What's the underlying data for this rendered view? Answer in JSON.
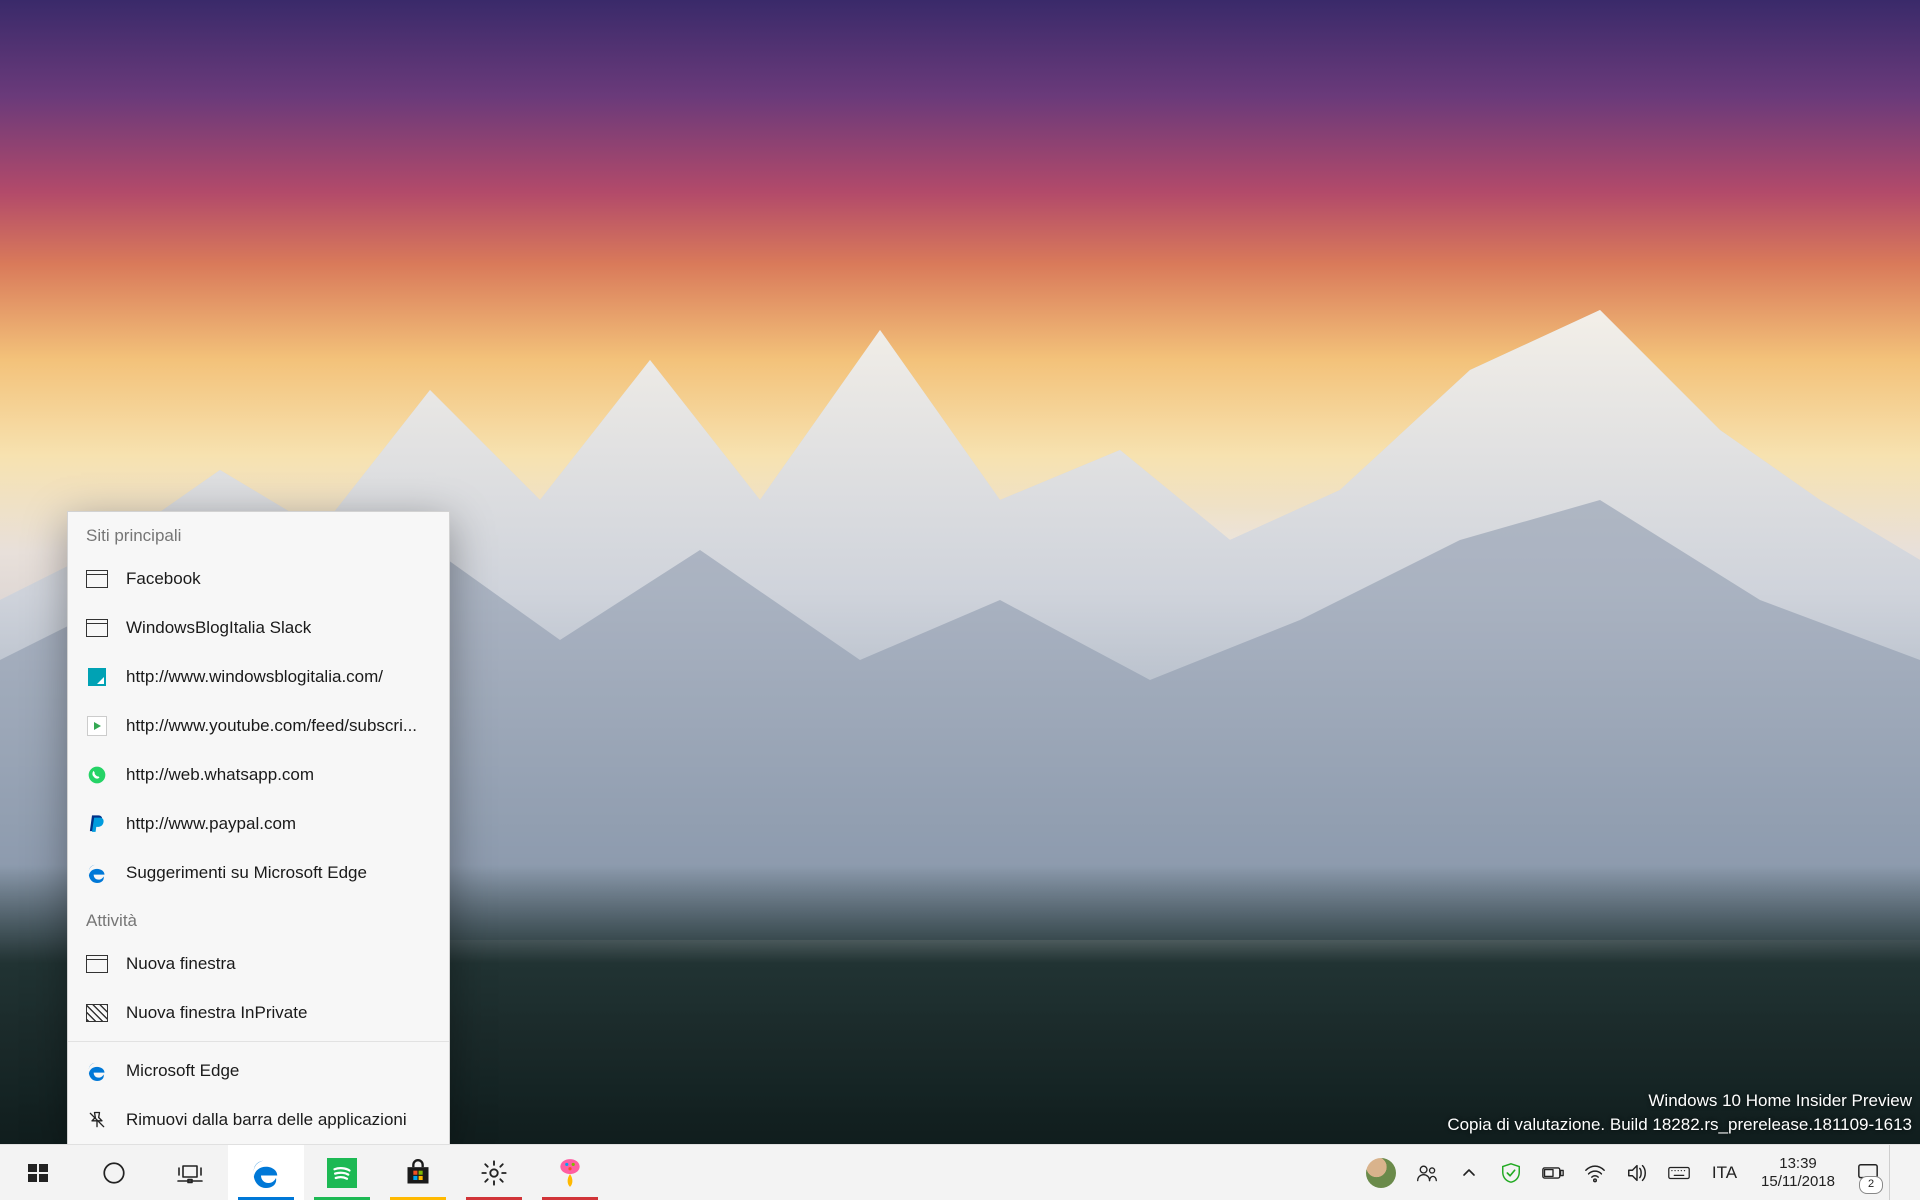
{
  "watermark": {
    "line1": "Windows 10 Home Insider Preview",
    "line2": "Copia di valutazione. Build 18282.rs_prerelease.181109-1613"
  },
  "jumplist": {
    "section1_title": "Siti principali",
    "top_sites": [
      {
        "label": "Facebook",
        "icon": "page"
      },
      {
        "label": "WindowsBlogItalia Slack",
        "icon": "page"
      },
      {
        "label": "http://www.windowsblogitalia.com/",
        "icon": "wbi"
      },
      {
        "label": "http://www.youtube.com/feed/subscri...",
        "icon": "yt"
      },
      {
        "label": "http://web.whatsapp.com",
        "icon": "wa"
      },
      {
        "label": "http://www.paypal.com",
        "icon": "pp"
      },
      {
        "label": "Suggerimenti su Microsoft Edge",
        "icon": "edge"
      }
    ],
    "section2_title": "Attività",
    "tasks": [
      {
        "label": "Nuova finestra",
        "icon": "page"
      },
      {
        "label": "Nuova finestra InPrivate",
        "icon": "hatch"
      }
    ],
    "footer": [
      {
        "label": "Microsoft Edge",
        "icon": "edge"
      },
      {
        "label": "Rimuovi dalla barra delle applicazioni",
        "icon": "pin"
      }
    ]
  },
  "taskbar": {
    "apps": [
      {
        "name": "start",
        "active": false
      },
      {
        "name": "cortana",
        "active": false
      },
      {
        "name": "task-view",
        "active": false
      },
      {
        "name": "edge",
        "active": true
      },
      {
        "name": "spotify",
        "active": false,
        "running": true,
        "accent": "#1db954"
      },
      {
        "name": "microsoft-store",
        "active": false,
        "running": true,
        "accent": "#ffb900"
      },
      {
        "name": "settings",
        "active": false,
        "running": true,
        "accent": "#d13438"
      },
      {
        "name": "paint3d",
        "active": false,
        "running": true,
        "accent": "#d13438"
      }
    ]
  },
  "tray": {
    "language": "ITA",
    "time": "13:39",
    "date": "15/11/2018",
    "notif_count": "2"
  }
}
